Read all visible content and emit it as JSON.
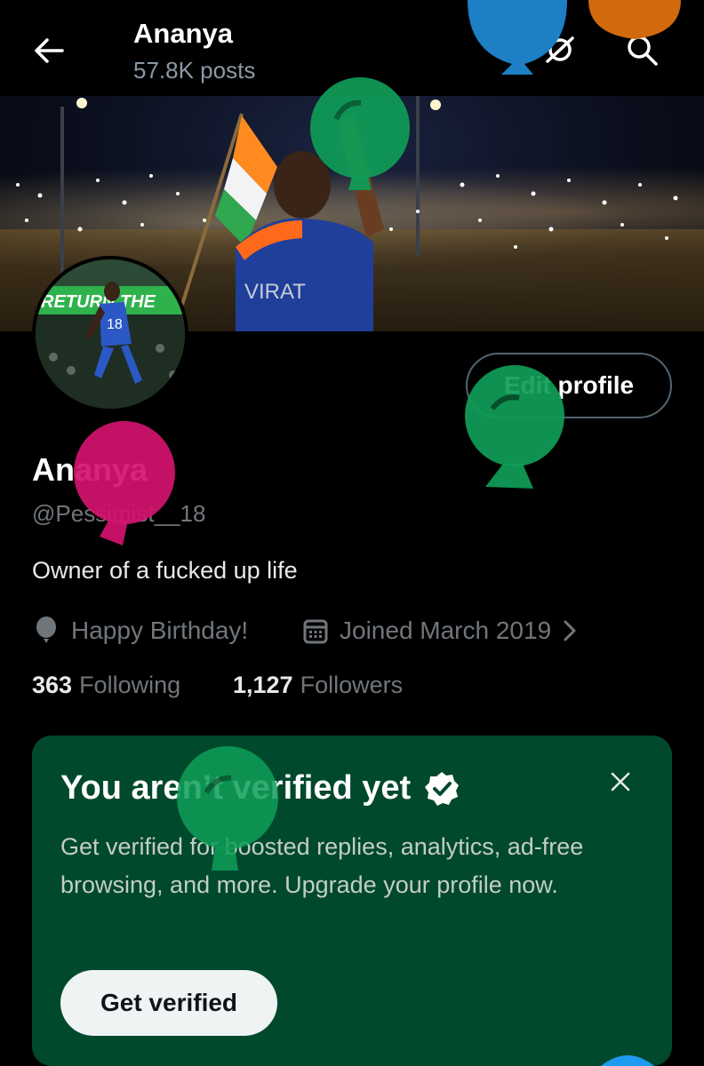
{
  "header": {
    "title": "Ananya",
    "posts_count": "57.8K posts"
  },
  "profile": {
    "display_name": "Ananya",
    "handle": "@Pessimist__18",
    "bio": "Owner of a fucked up life",
    "birthday_text": "Happy Birthday!",
    "joined_text": "Joined March 2019",
    "following_count": "363",
    "following_label": "Following",
    "followers_count": "1,127",
    "followers_label": "Followers",
    "edit_button_label": "Edit profile"
  },
  "banner": {
    "jersey_text": "VIRAT",
    "avatar_banner_text": "RETURN THE",
    "avatar_jersey_number": "18"
  },
  "verify_card": {
    "title": "You aren’t verified yet",
    "body": "Get verified for boosted replies, analytics, ad-free browsing, and more. Upgrade your profile now.",
    "button_label": "Get verified",
    "background": "#00492d"
  },
  "colors": {
    "balloon_blue": "#1d7fc4",
    "balloon_orange": "#d16a0c",
    "balloon_green": "#0f9d58",
    "balloon_pink": "#d4136e",
    "muted_text": "#71767b"
  },
  "icons": [
    "back-arrow-icon",
    "no-bell-icon",
    "search-icon",
    "balloon-icon",
    "calendar-icon",
    "chevron-right-icon",
    "close-icon",
    "verified-badge-icon"
  ]
}
